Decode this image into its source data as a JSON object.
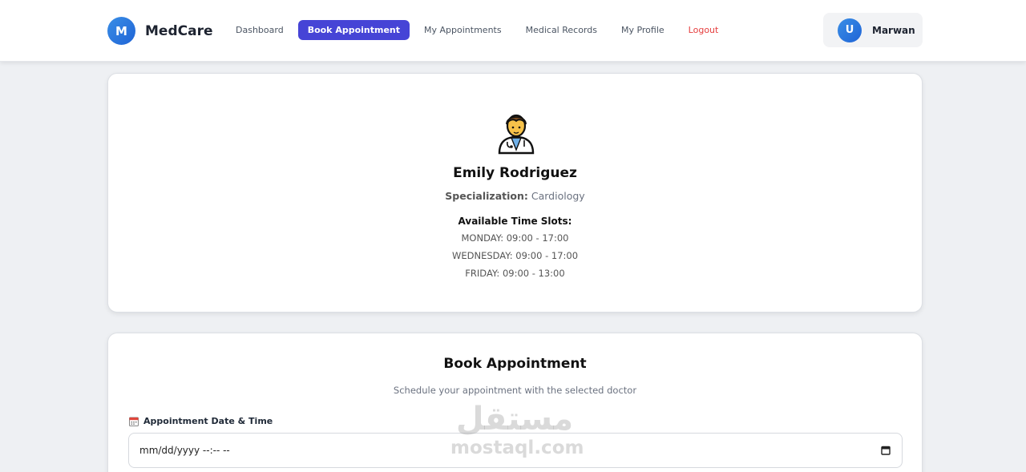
{
  "brand": {
    "logo_letter": "M",
    "name": "MedCare"
  },
  "nav": {
    "dashboard": "Dashboard",
    "book_appointment": "Book Appointment",
    "my_appointments": "My Appointments",
    "medical_records": "Medical Records",
    "my_profile": "My Profile",
    "logout": "Logout"
  },
  "user": {
    "avatar_letter": "U",
    "name": "Marwan"
  },
  "doctor": {
    "icon": "doctor-icon",
    "name": "Emily Rodriguez",
    "specialization_label": "Specialization:",
    "specialization": "Cardiology",
    "slots_title": "Available Time Slots:",
    "slots": [
      "MONDAY: 09:00 - 17:00",
      "WEDNESDAY: 09:00 - 17:00",
      "FRIDAY: 09:00 - 13:00"
    ]
  },
  "booking": {
    "title": "Book Appointment",
    "subtitle": "Schedule your appointment with the selected doctor",
    "date_label": "Appointment Date & Time",
    "date_placeholder": "mm/dd/yyyy --:-- --"
  },
  "watermark": {
    "arabic": "مستقل",
    "latin": "mostaql.com"
  },
  "colors": {
    "accent": "#4644d6",
    "logout": "#e53e3e",
    "brand_blue": "#1f64d6"
  }
}
